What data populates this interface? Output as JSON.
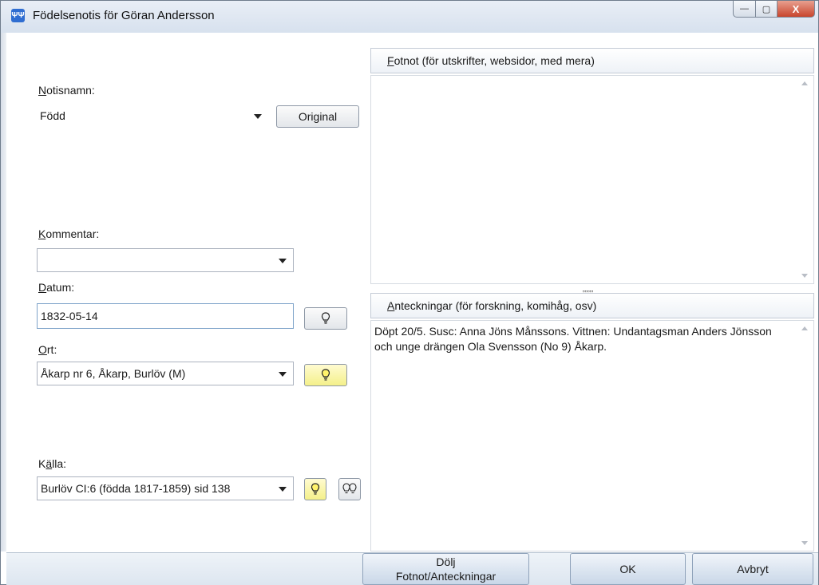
{
  "window": {
    "title": "Födelsenotis för Göran Andersson",
    "app_icon_glyph": "ΨΨ",
    "minimize_glyph": "—",
    "maximize_glyph": "▢",
    "close_glyph": "X"
  },
  "form": {
    "notisnamn": {
      "label_accel": "N",
      "label_rest": "otisnamn:",
      "value": "Född",
      "original_button": "Original"
    },
    "kommentar": {
      "label_accel": "K",
      "label_rest": "ommentar:",
      "value": ""
    },
    "datum": {
      "label_accel": "D",
      "label_rest": "atum:",
      "value": "1832-05-14"
    },
    "ort": {
      "label_accel": "O",
      "label_rest": "rt:",
      "value": "Åkarp nr 6, Åkarp, Burlöv (M)"
    },
    "kalla": {
      "label_pre": "K",
      "label_accel": "ä",
      "label_rest": "lla:",
      "value": "Burlöv CI:6 (födda 1817-1859) sid 138"
    }
  },
  "right": {
    "fotnot_header_accel": "F",
    "fotnot_header_rest": "otnot (för utskrifter, websidor, med mera)",
    "fotnot_text": "",
    "splitter_glyph": ",,,,,,,,,",
    "anteckningar_header_accel": "A",
    "anteckningar_header_rest": "nteckningar (för forskning, komihåg, osv)",
    "anteckningar_text": "Döpt 20/5. Susc: Anna Jöns Månssons. Vittnen: Undantagsman Anders Jönsson och unge drängen Ola Svensson (No 9) Åkarp."
  },
  "bottom": {
    "toggle_line1": "Dölj",
    "toggle_line2": "Fotnot/Anteckningar",
    "ok": "OK",
    "cancel": "Avbryt"
  },
  "colors": {
    "bulb_highlight": "#f4f08a",
    "input_focus_border": "#7ea3c9"
  }
}
